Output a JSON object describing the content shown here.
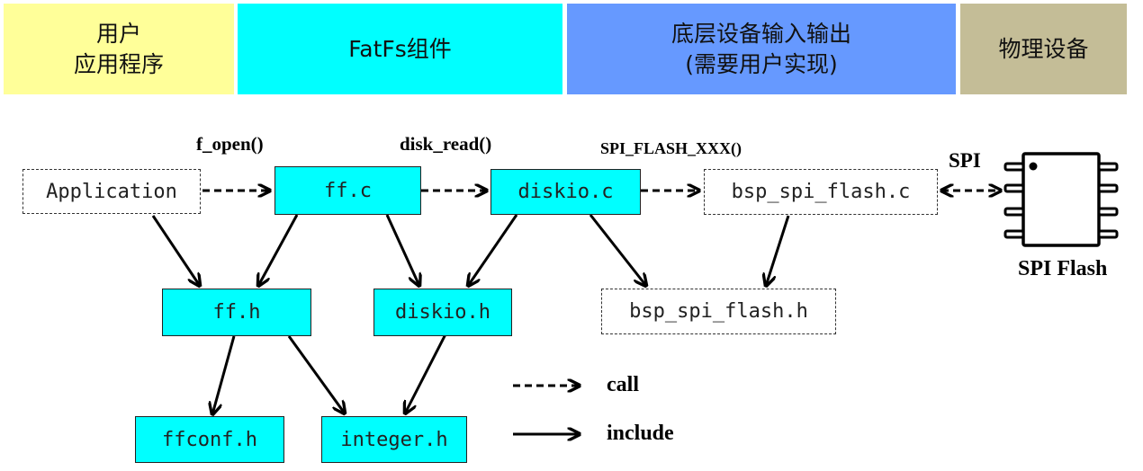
{
  "bands": {
    "app": {
      "lines": [
        "用户",
        "应用程序"
      ],
      "color": "#ffff99"
    },
    "fatfs": {
      "lines": [
        "FatFs组件"
      ],
      "color": "#00ffff"
    },
    "io": {
      "lines": [
        "底层设备输入输出",
        "(需要用户实现)"
      ],
      "color": "#6699ff"
    },
    "phys": {
      "lines": [
        "物理设备"
      ],
      "color": "#c4bd97"
    }
  },
  "nodes": {
    "application": {
      "label": "Application",
      "style": "dashed"
    },
    "ff_c": {
      "label": "ff.c",
      "style": "solid"
    },
    "diskio_c": {
      "label": "diskio.c",
      "style": "solid"
    },
    "bsp_spi_flash_c": {
      "label": "bsp_spi_flash.c",
      "style": "dashed"
    },
    "ff_h": {
      "label": "ff.h",
      "style": "solid"
    },
    "diskio_h": {
      "label": "diskio.h",
      "style": "solid"
    },
    "bsp_spi_flash_h": {
      "label": "bsp_spi_flash.h",
      "style": "dashed"
    },
    "ffconf_h": {
      "label": "ffconf.h",
      "style": "solid"
    },
    "integer_h": {
      "label": "integer.h",
      "style": "solid"
    }
  },
  "call_labels": {
    "f_open": "f_open()",
    "disk_read": "disk_read()",
    "spi_flash_xxx": "SPI_FLASH_XXX()",
    "spi": "SPI"
  },
  "chip": {
    "label": "SPI Flash",
    "pins_per_side": 4
  },
  "edges": [
    {
      "from": "application",
      "to": "ff_c",
      "type": "call"
    },
    {
      "from": "ff_c",
      "to": "diskio_c",
      "type": "call"
    },
    {
      "from": "diskio_c",
      "to": "bsp_spi_flash_c",
      "type": "call"
    },
    {
      "from": "bsp_spi_flash_c",
      "to": "spi_flash_chip",
      "type": "call-bidirectional"
    },
    {
      "from": "application",
      "to": "ff_h",
      "type": "include"
    },
    {
      "from": "ff_c",
      "to": "ff_h",
      "type": "include"
    },
    {
      "from": "ff_c",
      "to": "diskio_h",
      "type": "include"
    },
    {
      "from": "diskio_c",
      "to": "diskio_h",
      "type": "include"
    },
    {
      "from": "diskio_c",
      "to": "bsp_spi_flash_h",
      "type": "include"
    },
    {
      "from": "bsp_spi_flash_c",
      "to": "bsp_spi_flash_h",
      "type": "include"
    },
    {
      "from": "ff_h",
      "to": "ffconf_h",
      "type": "include"
    },
    {
      "from": "ff_h",
      "to": "integer_h",
      "type": "include"
    },
    {
      "from": "diskio_h",
      "to": "integer_h",
      "type": "include"
    }
  ],
  "legend": {
    "call": "call",
    "include": "include"
  }
}
